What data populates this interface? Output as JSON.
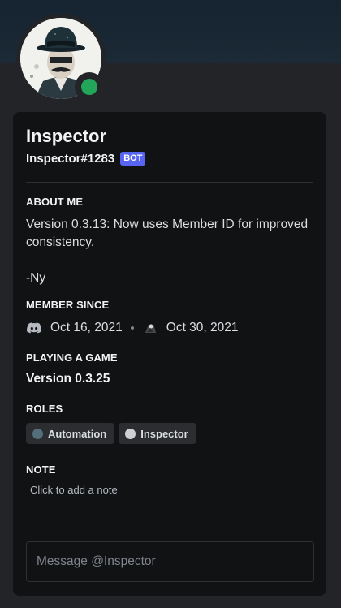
{
  "profile": {
    "name": "Inspector",
    "tag": "Inspector#1283",
    "badge": "BOT",
    "status": "online",
    "status_color": "#23a55a",
    "avatar_icon": "bowler-hat-man-avatar"
  },
  "about": {
    "title": "ABOUT ME",
    "text": "Version 0.3.13: Now uses Member ID for improved consistency.\n\n-Ny"
  },
  "member_since": {
    "title": "MEMBER SINCE",
    "discord_icon": "discord-icon",
    "discord_date": "Oct 16, 2021",
    "server_icon": "server-icon",
    "server_date": "Oct 30, 2021"
  },
  "activity": {
    "title": "PLAYING A GAME",
    "game": "Version 0.3.25"
  },
  "roles": {
    "title": "ROLES",
    "items": [
      {
        "label": "Automation",
        "color": "#546e7a"
      },
      {
        "label": "Inspector",
        "color": "#cfd0d4"
      }
    ]
  },
  "note": {
    "title": "NOTE",
    "placeholder": "Click to add a note"
  },
  "message": {
    "placeholder": "Message @Inspector"
  },
  "colors": {
    "accent": "#5865f2",
    "card": "#111214",
    "background": "#232428"
  }
}
